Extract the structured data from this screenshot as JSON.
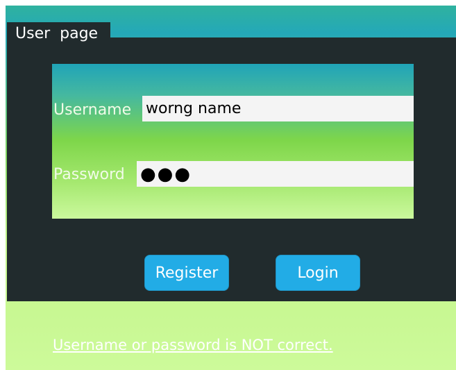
{
  "tab": {
    "label": "User  page"
  },
  "form": {
    "username_label": "Username",
    "username_value": "worng name",
    "password_label": "Password",
    "password_value": "●●●"
  },
  "buttons": {
    "register_label": "Register",
    "login_label": "Login"
  },
  "status": {
    "error_text": "Username or password is NOT correct."
  },
  "colors": {
    "panel_background": "#212b2d",
    "button_background": "#22ace6",
    "input_background": "#f4f4f4"
  }
}
